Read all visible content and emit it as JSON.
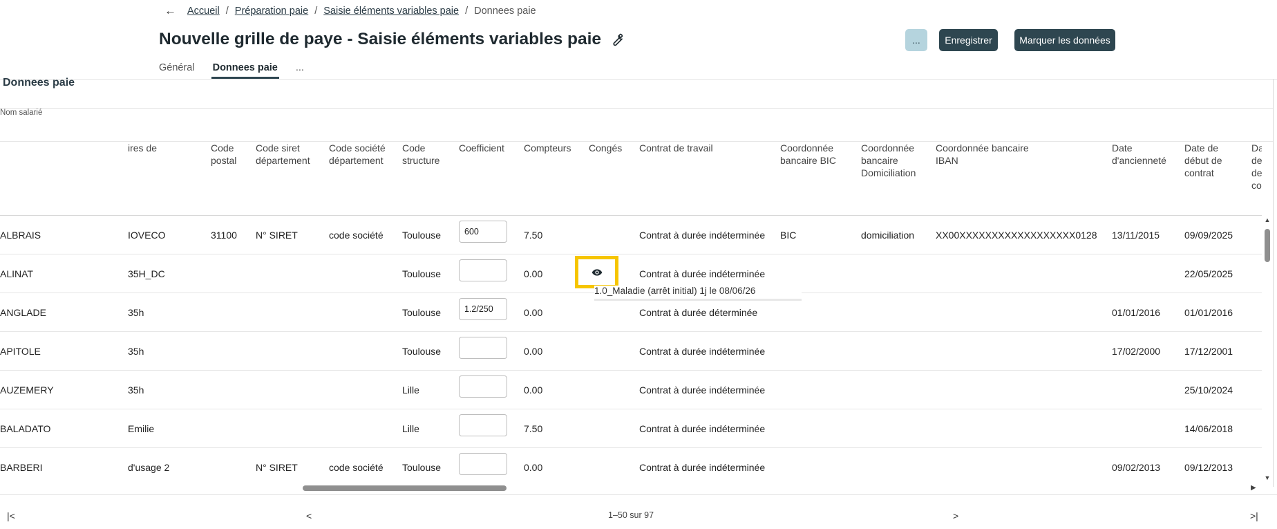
{
  "breadcrumb": {
    "back_icon": "arrow-left-icon",
    "items": [
      "Accueil",
      "Préparation paie",
      "Saisie éléments variables paie"
    ],
    "current": "Donnees paie",
    "separator": "/"
  },
  "title": "Nouvelle grille de paye - Saisie éléments variables paie",
  "title_icon": "wrench-icon",
  "actions": {
    "more_label": "...",
    "save_label": "Enregistrer",
    "mark_label": "Marquer les données"
  },
  "tabs": [
    {
      "label": "Général",
      "active": false
    },
    {
      "label": "Donnees paie",
      "active": true
    },
    {
      "label": "...",
      "active": false
    }
  ],
  "section_title": "Donnees paie",
  "nom_label": "Nom salarié",
  "table": {
    "headers": [
      "ires de",
      "Code postal",
      "Code siret département",
      "Code société département",
      "Code structure",
      "Coefficient",
      "Compteurs",
      "Congés",
      "Contrat de travail",
      "Coordonnée bancaire BIC",
      "Coordonnée bancaire Domiciliation",
      "Coordonnée bancaire IBAN",
      "Date d'ancienneté",
      "Date de début de contrat",
      "Date de fin de cont"
    ],
    "rows": [
      {
        "name": "ALBRAIS",
        "c1": "IOVECO",
        "postal": "31100",
        "siret": "N° SIRET",
        "societe": "code société",
        "structure": "Toulouse",
        "coef": "600",
        "compteurs": "7.50",
        "conges": "",
        "contrat": "Contrat à durée indéterminée",
        "bic": "BIC",
        "domiciliation": "domiciliation",
        "iban": "XX00XXXXXXXXXXXXXXXXXX0128",
        "anciennete": "13/11/2015",
        "debut": "09/09/2025"
      },
      {
        "name": "ALINAT",
        "c1": "35H_DC",
        "postal": "",
        "siret": "",
        "societe": "",
        "structure": "Toulouse",
        "coef": "",
        "compteurs": "0.00",
        "conges": "eye",
        "contrat": "Contrat à durée indéterminée",
        "bic": "",
        "domiciliation": "",
        "iban": "",
        "anciennete": "",
        "debut": "22/05/2025"
      },
      {
        "name": "ANGLADE",
        "c1": "35h",
        "postal": "",
        "siret": "",
        "societe": "",
        "structure": "Toulouse",
        "coef": "1.2/250",
        "compteurs": "0.00",
        "conges": "",
        "contrat": "Contrat à durée déterminée",
        "bic": "",
        "domiciliation": "",
        "iban": "",
        "anciennete": "01/01/2016",
        "debut": "01/01/2016"
      },
      {
        "name": "APITOLE",
        "c1": "35h",
        "postal": "",
        "siret": "",
        "societe": "",
        "structure": "Toulouse",
        "coef": "",
        "compteurs": "0.00",
        "conges": "",
        "contrat": "Contrat à durée indéterminée",
        "bic": "",
        "domiciliation": "",
        "iban": "",
        "anciennete": "17/02/2000",
        "debut": "17/12/2001"
      },
      {
        "name": "AUZEMERY",
        "c1": "35h",
        "postal": "",
        "siret": "",
        "societe": "",
        "structure": "Lille",
        "coef": "",
        "compteurs": "0.00",
        "conges": "",
        "contrat": "Contrat à durée indéterminée",
        "bic": "",
        "domiciliation": "",
        "iban": "",
        "anciennete": "",
        "debut": "25/10/2024"
      },
      {
        "name": "BALADATO",
        "c1": "Emilie",
        "postal": "",
        "siret": "",
        "societe": "",
        "structure": "Lille",
        "coef": "",
        "compteurs": "7.50",
        "conges": "",
        "contrat": "Contrat à durée indéterminée",
        "bic": "",
        "domiciliation": "",
        "iban": "",
        "anciennete": "",
        "debut": "14/06/2018"
      },
      {
        "name": "BARBERI",
        "c1": "d'usage 2",
        "postal": "",
        "siret": "N° SIRET",
        "societe": "code société",
        "structure": "Toulouse",
        "coef": "",
        "compteurs": "0.00",
        "conges": "",
        "contrat": "Contrat à durée indéterminée",
        "bic": "",
        "domiciliation": "",
        "iban": "",
        "anciennete": "09/02/2013",
        "debut": "09/12/2013"
      }
    ]
  },
  "tooltip": "1.0_Maladie (arrêt initial) 1j le 08/06/26",
  "conges_icon": "eye-icon",
  "pagination": {
    "first": "|<",
    "prev": "<",
    "info": "1–50 sur 97",
    "next": ">",
    "last": ">|"
  },
  "colors": {
    "primary": "#2e4650",
    "secondary_button": "#b5d4de",
    "highlight": "#f6c500"
  }
}
